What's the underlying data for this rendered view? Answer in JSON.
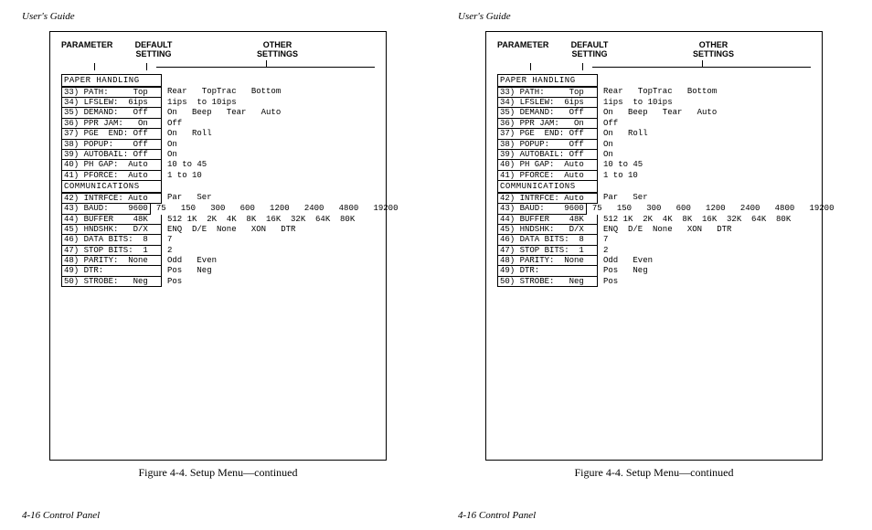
{
  "doc": {
    "header": "User's Guide",
    "footer": "4-16 Control Panel",
    "caption": "Figure 4-4.  Setup Menu—continued",
    "columns": {
      "parameter": "PARAMETER",
      "default_l1": "DEFAULT",
      "default_l2": "SETTING",
      "other_l1": "OTHER",
      "other_l2": "SETTINGS"
    },
    "sections": [
      {
        "title": "PAPER  HANDLING",
        "rows": [
          {
            "param": "33) PATH:     Top",
            "other": "Rear   TopTrac   Bottom"
          },
          {
            "param": "34) LFSLEW:  6ips",
            "other": "1ips  to 10ips"
          },
          {
            "param": "35) DEMAND:   Off",
            "other": "On   Beep   Tear   Auto"
          },
          {
            "param": "36) PPR JAM:   On",
            "other": "Off"
          },
          {
            "param": "37) PGE  END: Off",
            "other": "On   Roll"
          },
          {
            "param": "38) POPUP:    Off",
            "other": "On"
          },
          {
            "param": "39) AUTOBAIL: Off",
            "other": "On"
          },
          {
            "param": "40) PH GAP:  Auto",
            "other": "10 to 45"
          },
          {
            "param": "41) PFORCE:  Auto",
            "other": "1 to 10"
          }
        ]
      },
      {
        "title": "COMMUNICATIONS",
        "rows": [
          {
            "param": "42) INTRFCE: Auto",
            "other": "Par   Ser"
          },
          {
            "param": "43) BAUD:    9600",
            "other": "75   150   300   600   1200   2400   4800   19200"
          },
          {
            "param": "44) BUFFER    48K",
            "other": "512 1K  2K  4K  8K  16K  32K  64K  80K"
          },
          {
            "param": "45) HNDSHK:   D/X",
            "other": "ENQ  D/E  None   XON   DTR"
          },
          {
            "param": "46) DATA BITS:  8",
            "other": "7"
          },
          {
            "param": "47) STOP BITS:  1",
            "other": "2"
          },
          {
            "param": "48) PARITY:  None",
            "other": "Odd   Even"
          },
          {
            "param": "49) DTR:         ",
            "other": "Pos   Neg"
          },
          {
            "param": "50) STROBE:   Neg",
            "other": "Pos"
          }
        ]
      }
    ]
  }
}
